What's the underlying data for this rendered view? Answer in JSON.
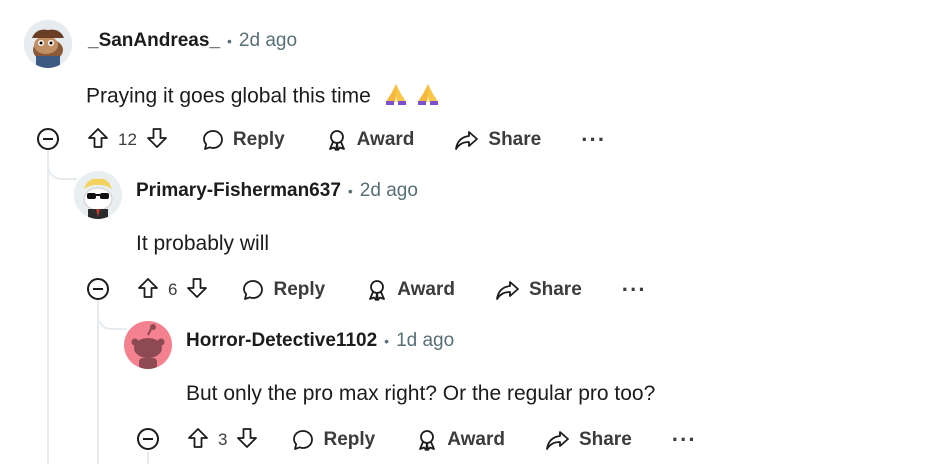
{
  "comments": [
    {
      "author": "_SanAndreas_",
      "time": "2d ago",
      "body": "Praying it goes global this time",
      "emojis": [
        "folded-hands",
        "folded-hands"
      ],
      "score": "12",
      "actions": {
        "reply": "Reply",
        "award": "Award",
        "share": "Share",
        "more": "···"
      }
    },
    {
      "author": "Primary-Fisherman637",
      "time": "2d ago",
      "body": "It probably will",
      "score": "6",
      "actions": {
        "reply": "Reply",
        "award": "Award",
        "share": "Share",
        "more": "···"
      }
    },
    {
      "author": "Horror-Detective1102",
      "time": "1d ago",
      "body": "But only the pro max right? Or the regular pro too?",
      "score": "3",
      "actions": {
        "reply": "Reply",
        "award": "Award",
        "share": "Share",
        "more": "···"
      }
    }
  ],
  "separator": "•",
  "colors": {
    "text": "#1c1c1c",
    "meta": "#576f76",
    "thread_line": "#e5ebee",
    "avatar3_bg": "#f4818f"
  }
}
